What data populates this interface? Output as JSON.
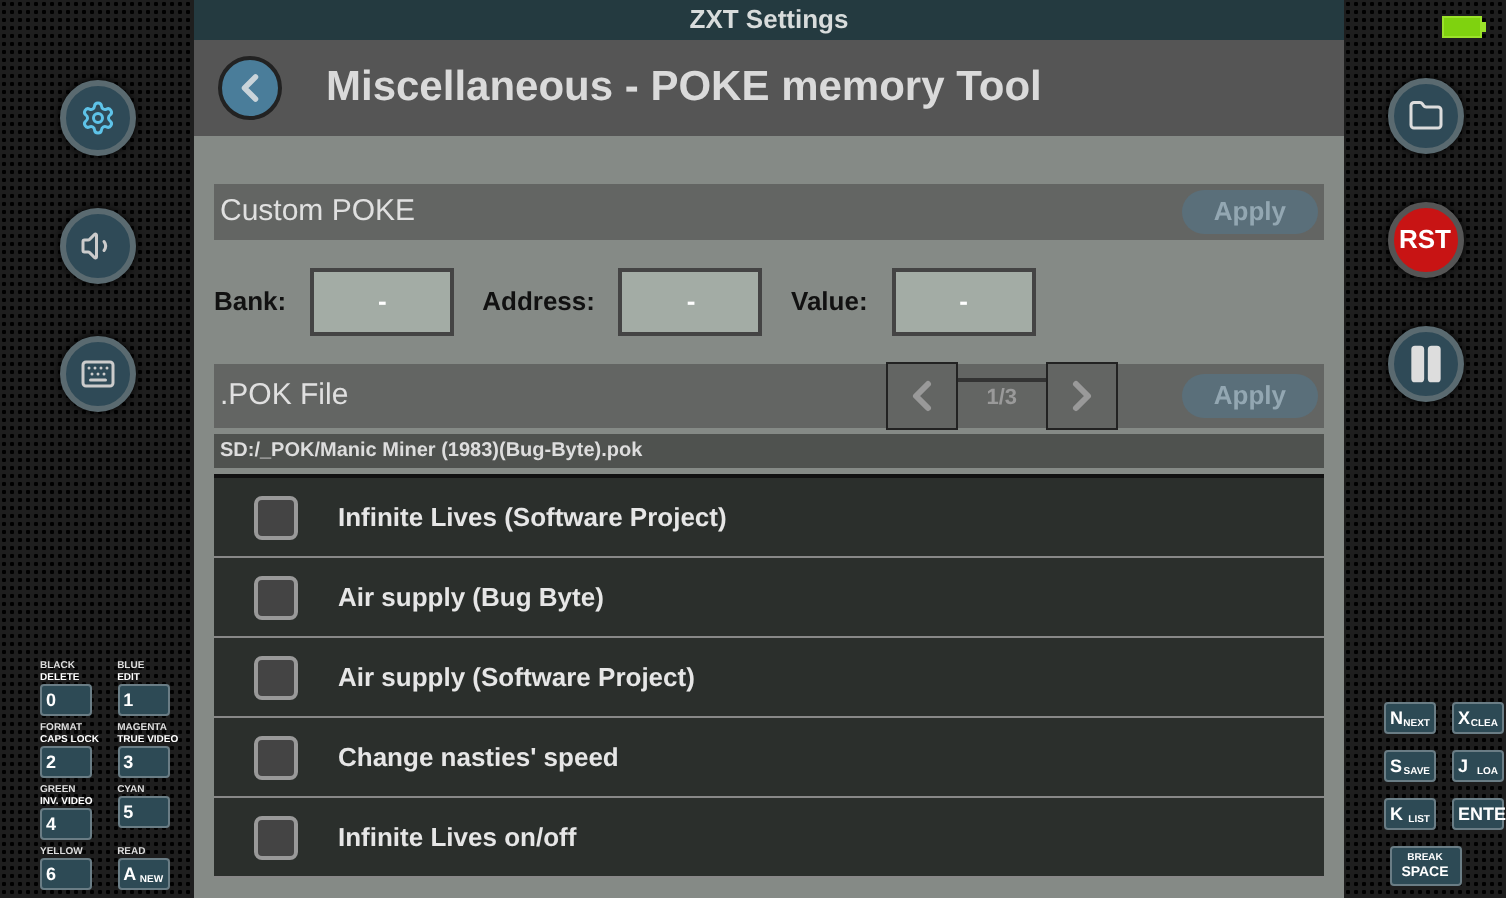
{
  "window": {
    "title": "ZXT Settings"
  },
  "header": {
    "title": "Miscellaneous - POKE memory Tool"
  },
  "left_buttons": [
    {
      "kind": "settings"
    },
    {
      "kind": "sound"
    },
    {
      "kind": "keyboard"
    }
  ],
  "right_buttons": [
    {
      "kind": "folder"
    },
    {
      "kind": "reset",
      "label": "RST"
    },
    {
      "kind": "pause"
    }
  ],
  "custom_poke": {
    "title": "Custom POKE",
    "apply": "Apply",
    "fields": [
      {
        "label": "Bank:",
        "value": "-"
      },
      {
        "label": "Address:",
        "value": "-"
      },
      {
        "label": "Value:",
        "value": "-"
      }
    ]
  },
  "pok_file": {
    "title": ".POK File",
    "page": "1/3",
    "apply": "Apply",
    "path": "SD:/_POK/Manic Miner (1983)(Bug-Byte).pok"
  },
  "pokes": [
    {
      "label": "Infinite Lives (Software Project)",
      "checked": false
    },
    {
      "label": "Air supply (Bug Byte)",
      "checked": false
    },
    {
      "label": "Air supply (Software Project)",
      "checked": false
    },
    {
      "label": "Change nasties' speed",
      "checked": false
    },
    {
      "label": "Infinite Lives on/off",
      "checked": false
    }
  ],
  "left_keys": [
    {
      "key": "0",
      "top": "BLACK",
      "caption": "DELETE"
    },
    {
      "key": "1",
      "top": "BLUE",
      "caption": "EDIT"
    },
    {
      "key": "2",
      "top": "FORMAT",
      "caption": "CAPS LOCK"
    },
    {
      "key": "3",
      "top": "MAGENTA",
      "caption": "TRUE VIDEO"
    },
    {
      "key": "4",
      "top": "GREEN",
      "caption": "INV. VIDEO"
    },
    {
      "key": "5",
      "top": "CYAN"
    },
    {
      "key": "6",
      "top": "YELLOW"
    },
    {
      "key": "A",
      "top": "READ",
      "sub": "NEW"
    }
  ],
  "right_keys": [
    {
      "key": "N",
      "sub": "NEXT"
    },
    {
      "key": "X",
      "sub": "CLEA"
    },
    {
      "key": "S",
      "sub": "SAVE"
    },
    {
      "key": "J",
      "sub": "LOA"
    },
    {
      "key": "K",
      "sub": "LIST"
    },
    {
      "key": "ENTE"
    }
  ],
  "space_key": {
    "top": "BREAK",
    "label": "SPACE"
  }
}
